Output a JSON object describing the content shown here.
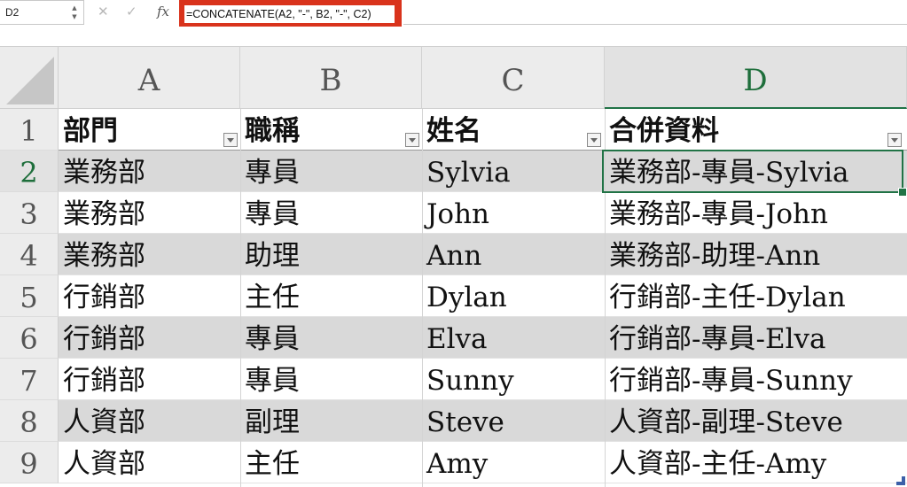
{
  "formula_bar": {
    "name_box": "D2",
    "stepper_up": "▲",
    "stepper_down": "▼",
    "cancel_glyph": "✕",
    "enter_glyph": "✓",
    "fx_label": "fx",
    "formula": "=CONCATENATE(A2, \"-\", B2, \"-\", C2)",
    "highlight_color": "#d9331c"
  },
  "columns": [
    "A",
    "B",
    "C",
    "D"
  ],
  "active_column": "D",
  "row_numbers": [
    "1",
    "2",
    "3",
    "4",
    "5",
    "6",
    "7",
    "8",
    "9"
  ],
  "active_row": "2",
  "table": {
    "headers": [
      "部門",
      "職稱",
      "姓名",
      "合併資料"
    ],
    "rows": [
      [
        "業務部",
        "專員",
        "Sylvia",
        "業務部-專員-Sylvia"
      ],
      [
        "業務部",
        "專員",
        "John",
        "業務部-專員-John"
      ],
      [
        "業務部",
        "助理",
        "Ann",
        "業務部-助理-Ann"
      ],
      [
        "行銷部",
        "主任",
        "Dylan",
        "行銷部-主任-Dylan"
      ],
      [
        "行銷部",
        "專員",
        "Elva",
        "行銷部-專員-Elva"
      ],
      [
        "行銷部",
        "專員",
        "Sunny",
        "行銷部-專員-Sunny"
      ],
      [
        "人資部",
        "副理",
        "Steve",
        "人資部-副理-Steve"
      ],
      [
        "人資部",
        "主任",
        "Amy",
        "人資部-主任-Amy"
      ]
    ]
  },
  "colors": {
    "selection": "#217346",
    "band_shade": "#d9d9d9",
    "header_bg": "#ececec"
  },
  "icons": {
    "filter": "filter-dropdown-icon",
    "resize": "table-resize-handle-icon"
  }
}
